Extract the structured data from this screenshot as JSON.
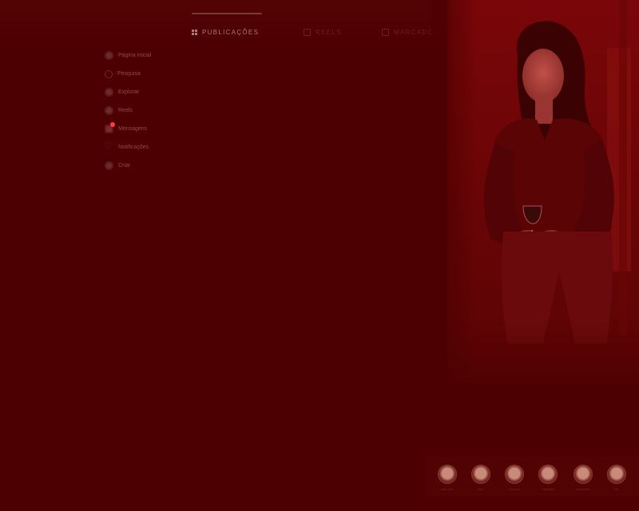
{
  "tabs": [
    {
      "label": "PUBLICAÇÕES",
      "icon": "grid-icon",
      "active": true
    },
    {
      "label": "REELS",
      "icon": "reels-icon",
      "active": false
    },
    {
      "label": "MARCADOS",
      "icon": "tagged-icon",
      "active": false
    }
  ],
  "sidebar": {
    "items": [
      {
        "label": "Página inicial",
        "icon": "home-icon"
      },
      {
        "label": "Pesquisa",
        "icon": "search-icon"
      },
      {
        "label": "Explorar",
        "icon": "explore-icon"
      },
      {
        "label": "Reels",
        "icon": "reels-icon"
      },
      {
        "label": "Mensagens",
        "icon": "messages-icon"
      },
      {
        "label": "Notificações",
        "icon": "heart-icon"
      },
      {
        "label": "Criar",
        "icon": "create-icon"
      }
    ]
  },
  "stories": [
    {
      "label": "user.one"
    },
    {
      "label": "user"
    },
    {
      "label": "friend.a"
    },
    {
      "label": "highlight"
    },
    {
      "label": "memories"
    },
    {
      "label": "life"
    }
  ],
  "colors": {
    "background": "#4d0002",
    "overlay_tint": "#8b0000",
    "notification_dot": "#ff3b3b"
  }
}
